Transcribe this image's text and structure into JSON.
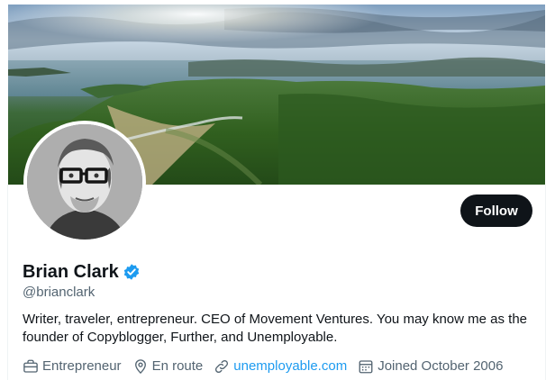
{
  "profile": {
    "name": "Brian Clark",
    "handle": "@brianclark",
    "verified": true,
    "bio": "Writer, traveler, entrepreneur. CEO of Movement Ventures. You may know me as the founder of Copyblogger, Further, and Unemployable.",
    "meta": {
      "profession": "Entrepreneur",
      "location": "En route",
      "website": "unemployable.com",
      "joined": "Joined October 2006"
    }
  },
  "actions": {
    "follow_label": "Follow"
  },
  "icons": {
    "profession": "briefcase-icon",
    "location": "location-pin-icon",
    "website": "link-icon",
    "joined": "calendar-icon",
    "verified": "verified-badge-icon"
  },
  "colors": {
    "accent": "#1d9bf0",
    "text_primary": "#0f1419",
    "text_secondary": "#536471",
    "follow_bg": "#0f1419"
  }
}
